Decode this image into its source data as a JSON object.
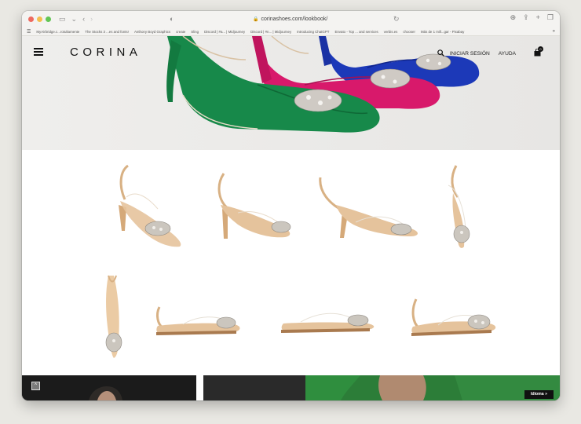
{
  "browser": {
    "url": "corinashoes.com/lookbook/",
    "bookmarks": [
      "MyAirbridge.c...rotultamente",
      "The Stocks 3 ...es and fonts!",
      "Anthony Boyd Graphics",
      "create",
      "Sling",
      "Discord | #a... | Midjourney",
      "Discord | #n... | Midjourney",
      "Introducing ChatGPT",
      "Envato - Top ... and services",
      "verbis.es",
      "chooser",
      "Más de 1 mill...gar - Pixabay"
    ]
  },
  "header": {
    "brand": "CORINA",
    "login_label": "INICIAR SESIÓN",
    "help_label": "AYUDA",
    "cart_count": "0"
  },
  "colors": {
    "hero_green": "#17894a",
    "hero_pink": "#d8196b",
    "hero_blue": "#1c39b8",
    "nude": "#dab58b"
  },
  "footer": {
    "language_button": "Idioma »",
    "scroll_top": "^"
  }
}
